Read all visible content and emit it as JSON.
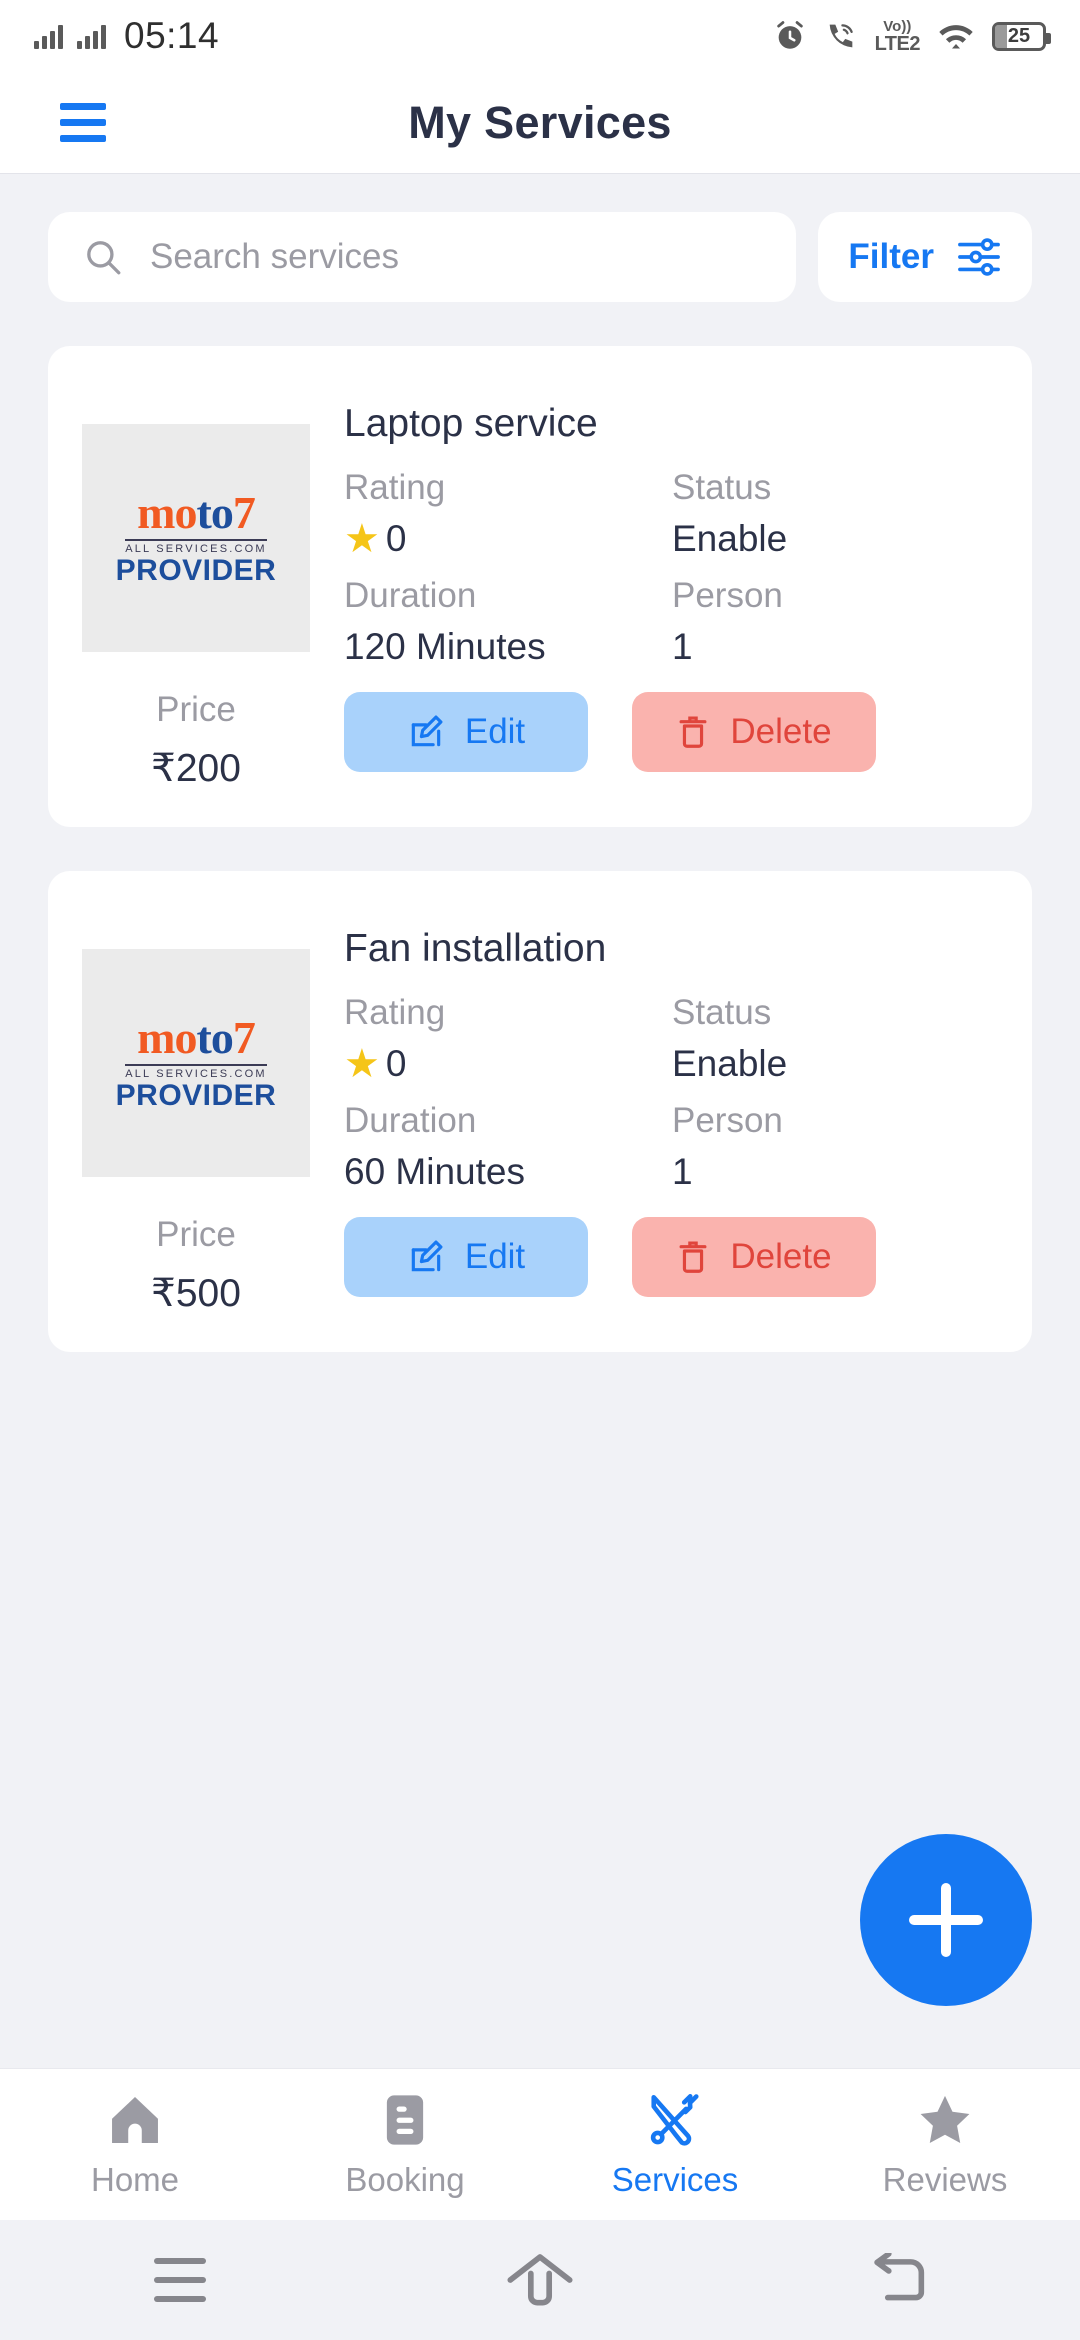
{
  "status_bar": {
    "time": "05:14",
    "battery_percent": "25",
    "volte_top": "Vo))",
    "volte_bottom": "LTE2",
    "icons": [
      "signal-bars-sim1",
      "signal-bars-sim2",
      "alarm-icon",
      "wifi-calling-icon",
      "volte-icon",
      "wifi-icon",
      "battery-icon"
    ]
  },
  "app_bar": {
    "menu_icon": "hamburger-menu-icon",
    "title": "My Services"
  },
  "search": {
    "placeholder": "Search services",
    "icon": "search-icon"
  },
  "filter": {
    "label": "Filter",
    "icon": "sliders-icon"
  },
  "logo": {
    "part1": "mo",
    "part2": "to",
    "part3": "7",
    "tagline": "ALL SERVICES.COM",
    "subtitle": "PROVIDER"
  },
  "labels": {
    "rating": "Rating",
    "status": "Status",
    "duration": "Duration",
    "person": "Person",
    "price": "Price",
    "edit": "Edit",
    "delete": "Delete",
    "star": "★"
  },
  "services": [
    {
      "title": "Laptop service",
      "rating": "0",
      "status": "Enable",
      "duration": "120 Minutes",
      "person": "1",
      "price": "₹200"
    },
    {
      "title": "Fan installation",
      "rating": "0",
      "status": "Enable",
      "duration": "60 Minutes",
      "person": "1",
      "price": "₹500"
    }
  ],
  "fab": {
    "icon": "plus-icon"
  },
  "bottom_nav": {
    "items": [
      {
        "label": "Home",
        "icon": "home-icon",
        "active": false
      },
      {
        "label": "Booking",
        "icon": "document-icon",
        "active": false
      },
      {
        "label": "Services",
        "icon": "tools-icon",
        "active": true
      },
      {
        "label": "Reviews",
        "icon": "star-icon",
        "active": false
      }
    ]
  },
  "system_nav": {
    "recents": "recents-icon",
    "home": "system-home-icon",
    "back": "back-icon"
  },
  "colors": {
    "accent": "#1678f2",
    "title": "#2b3147",
    "muted": "#9b9ba3",
    "edit_bg": "#a9d2fb",
    "delete_bg": "#fab3ae",
    "delete_fg": "#e0453c",
    "star": "#f5c518",
    "page_bg": "#f1f2f6"
  }
}
